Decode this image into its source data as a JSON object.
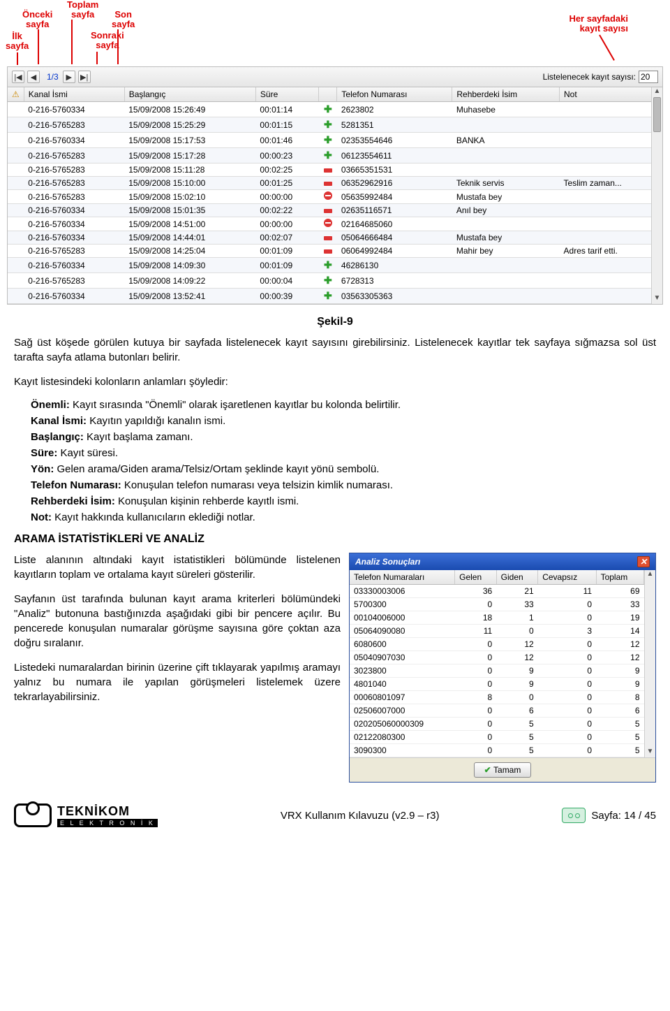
{
  "annotations": {
    "ilk_sayfa": "İlk\nsayfa",
    "onceki_sayfa": "Önceki\nsayfa",
    "toplam_sayfa": "Toplam\nsayfa",
    "sonraki_sayfa": "Sonraki\nsayfa",
    "son_sayfa": "Son\nsayfa",
    "her_sayfadaki": "Her sayfadaki\nkayıt sayısı"
  },
  "toolbar": {
    "first": "|◀",
    "prev": "◀",
    "page": "1/3",
    "next": "▶",
    "last": "▶|",
    "list_label": "Listelenecek kayıt sayısı:",
    "list_value": "20"
  },
  "grid": {
    "headers": {
      "warn": "⚠",
      "kanal": "Kanal İsmi",
      "baslangic": "Başlangıç",
      "sure": "Süre",
      "yon": "",
      "telefon": "Telefon Numarası",
      "rehber": "Rehberdeki İsim",
      "not": "Not"
    },
    "rows": [
      {
        "kanal": "0-216-5760334",
        "bas": "15/09/2008  15:26:49",
        "sure": "00:01:14",
        "dir": "in",
        "tel": "2623802",
        "reh": "Muhasebe",
        "not": ""
      },
      {
        "kanal": "0-216-5765283",
        "bas": "15/09/2008  15:25:29",
        "sure": "00:01:15",
        "dir": "in",
        "tel": "5281351",
        "reh": "",
        "not": ""
      },
      {
        "kanal": "0-216-5760334",
        "bas": "15/09/2008  15:17:53",
        "sure": "00:01:46",
        "dir": "in",
        "tel": "02353554646",
        "reh": "BANKA",
        "not": ""
      },
      {
        "kanal": "0-216-5765283",
        "bas": "15/09/2008  15:17:28",
        "sure": "00:00:23",
        "dir": "in",
        "tel": "06123554611",
        "reh": "",
        "not": ""
      },
      {
        "kanal": "0-216-5765283",
        "bas": "15/09/2008  15:11:28",
        "sure": "00:02:25",
        "dir": "out",
        "tel": "03665351531",
        "reh": "",
        "not": ""
      },
      {
        "kanal": "0-216-5765283",
        "bas": "15/09/2008  15:10:00",
        "sure": "00:01:25",
        "dir": "out",
        "tel": "06352962916",
        "reh": "Teknik servis",
        "not": "Teslim zaman..."
      },
      {
        "kanal": "0-216-5765283",
        "bas": "15/09/2008  15:02:10",
        "sure": "00:00:00",
        "dir": "miss",
        "tel": "05635992484",
        "reh": "Mustafa bey",
        "not": ""
      },
      {
        "kanal": "0-216-5760334",
        "bas": "15/09/2008  15:01:35",
        "sure": "00:02:22",
        "dir": "out",
        "tel": "02635116571",
        "reh": "Anıl bey",
        "not": ""
      },
      {
        "kanal": "0-216-5760334",
        "bas": "15/09/2008  14:51:00",
        "sure": "00:00:00",
        "dir": "miss",
        "tel": "02164685060",
        "reh": "",
        "not": ""
      },
      {
        "kanal": "0-216-5760334",
        "bas": "15/09/2008  14:44:01",
        "sure": "00:02:07",
        "dir": "out",
        "tel": "05064666484",
        "reh": "Mustafa bey",
        "not": ""
      },
      {
        "kanal": "0-216-5765283",
        "bas": "15/09/2008  14:25:04",
        "sure": "00:01:09",
        "dir": "out",
        "tel": "06064992484",
        "reh": "Mahir bey",
        "not": "Adres tarif etti."
      },
      {
        "kanal": "0-216-5760334",
        "bas": "15/09/2008  14:09:30",
        "sure": "00:01:09",
        "dir": "in",
        "tel": "46286130",
        "reh": "",
        "not": ""
      },
      {
        "kanal": "0-216-5765283",
        "bas": "15/09/2008  14:09:22",
        "sure": "00:00:04",
        "dir": "in",
        "tel": "6728313",
        "reh": "",
        "not": ""
      },
      {
        "kanal": "0-216-5760334",
        "bas": "15/09/2008  13:52:41",
        "sure": "00:00:39",
        "dir": "in",
        "tel": "03563305363",
        "reh": "",
        "not": ""
      }
    ]
  },
  "caption": "Şekil-9",
  "para1": "Sağ üst köşede görülen kutuya bir sayfada listelenecek kayıt sayısını girebilirsiniz. Listelenecek kayıtlar tek sayfaya sığmazsa sol üst tarafta sayfa atlama butonları belirir.",
  "para2": "Kayıt listesindeki kolonların anlamları şöyledir:",
  "defs": {
    "onemli_b": "Önemli:",
    "onemli_t": " Kayıt sırasında \"Önemli\" olarak işaretlenen kayıtlar bu kolonda belirtilir.",
    "kanal_b": "Kanal İsmi:",
    "kanal_t": " Kayıtın yapıldığı kanalın ismi.",
    "baslangic_b": "Başlangıç:",
    "baslangic_t": " Kayıt başlama zamanı.",
    "sure_b": "Süre:",
    "sure_t": " Kayıt süresi.",
    "yon_b": "Yön:",
    "yon_t": " Gelen arama/Giden arama/Telsiz/Ortam şeklinde kayıt yönü sembolü.",
    "tel_b": "Telefon Numarası:",
    "tel_t": " Konuşulan telefon numarası veya telsizin kimlik numarası.",
    "reh_b": "Rehberdeki İsim:",
    "reh_t": " Konuşulan kişinin rehberde kayıtlı ismi.",
    "not_b": "Not:",
    "not_t": " Kayıt hakkında kullanıcıların eklediği notlar."
  },
  "section2": "ARAMA İSTATİSTİKLERİ VE ANALİZ",
  "left_p1": "Liste alanının altındaki kayıt istatistikleri bölümünde listelenen kayıtların toplam ve ortalama kayıt süreleri gösterilir.",
  "left_p2": "Sayfanın üst tarafında bulunan kayıt arama kriterleri bölümündeki \"Analiz\" butonuna bastığınızda aşağıdaki gibi bir pencere açılır. Bu pencerede konuşulan numaralar görüşme sayısına göre çoktan aza doğru sıralanır.",
  "left_p3": "Listedeki numaralardan birinin üzerine çift tıklayarak yapılmış aramayı yalnız bu numara ile yapılan görüşmeleri listelemek üzere tekrarlayabilirsiniz.",
  "dialog": {
    "title": "Analiz Sonuçları",
    "headers": {
      "tel": "Telefon Numaraları",
      "gelen": "Gelen",
      "giden": "Giden",
      "cevapsiz": "Cevapsız",
      "toplam": "Toplam"
    },
    "rows": [
      {
        "t": "03330003006",
        "g": "36",
        "gi": "21",
        "c": "11",
        "tp": "69"
      },
      {
        "t": "5700300",
        "g": "0",
        "gi": "33",
        "c": "0",
        "tp": "33"
      },
      {
        "t": "00104006000",
        "g": "18",
        "gi": "1",
        "c": "0",
        "tp": "19"
      },
      {
        "t": "05064090080",
        "g": "11",
        "gi": "0",
        "c": "3",
        "tp": "14"
      },
      {
        "t": "6080600",
        "g": "0",
        "gi": "12",
        "c": "0",
        "tp": "12"
      },
      {
        "t": "05040907030",
        "g": "0",
        "gi": "12",
        "c": "0",
        "tp": "12"
      },
      {
        "t": "3023800",
        "g": "0",
        "gi": "9",
        "c": "0",
        "tp": "9"
      },
      {
        "t": "4801040",
        "g": "0",
        "gi": "9",
        "c": "0",
        "tp": "9"
      },
      {
        "t": "00060801097",
        "g": "8",
        "gi": "0",
        "c": "0",
        "tp": "8"
      },
      {
        "t": "02506007000",
        "g": "0",
        "gi": "6",
        "c": "0",
        "tp": "6"
      },
      {
        "t": "020205060000309",
        "g": "0",
        "gi": "5",
        "c": "0",
        "tp": "5"
      },
      {
        "t": "02122080300",
        "g": "0",
        "gi": "5",
        "c": "0",
        "tp": "5"
      },
      {
        "t": "3090300",
        "g": "0",
        "gi": "5",
        "c": "0",
        "tp": "5"
      }
    ],
    "ok": "Tamam"
  },
  "footer": {
    "brand": "TEKNİKOM",
    "brand_sub": "E L E K T R O N İ K",
    "center": "VRX Kullanım Kılavuzu (v2.9 – r3)",
    "right": "Sayfa: 14 / 45"
  }
}
